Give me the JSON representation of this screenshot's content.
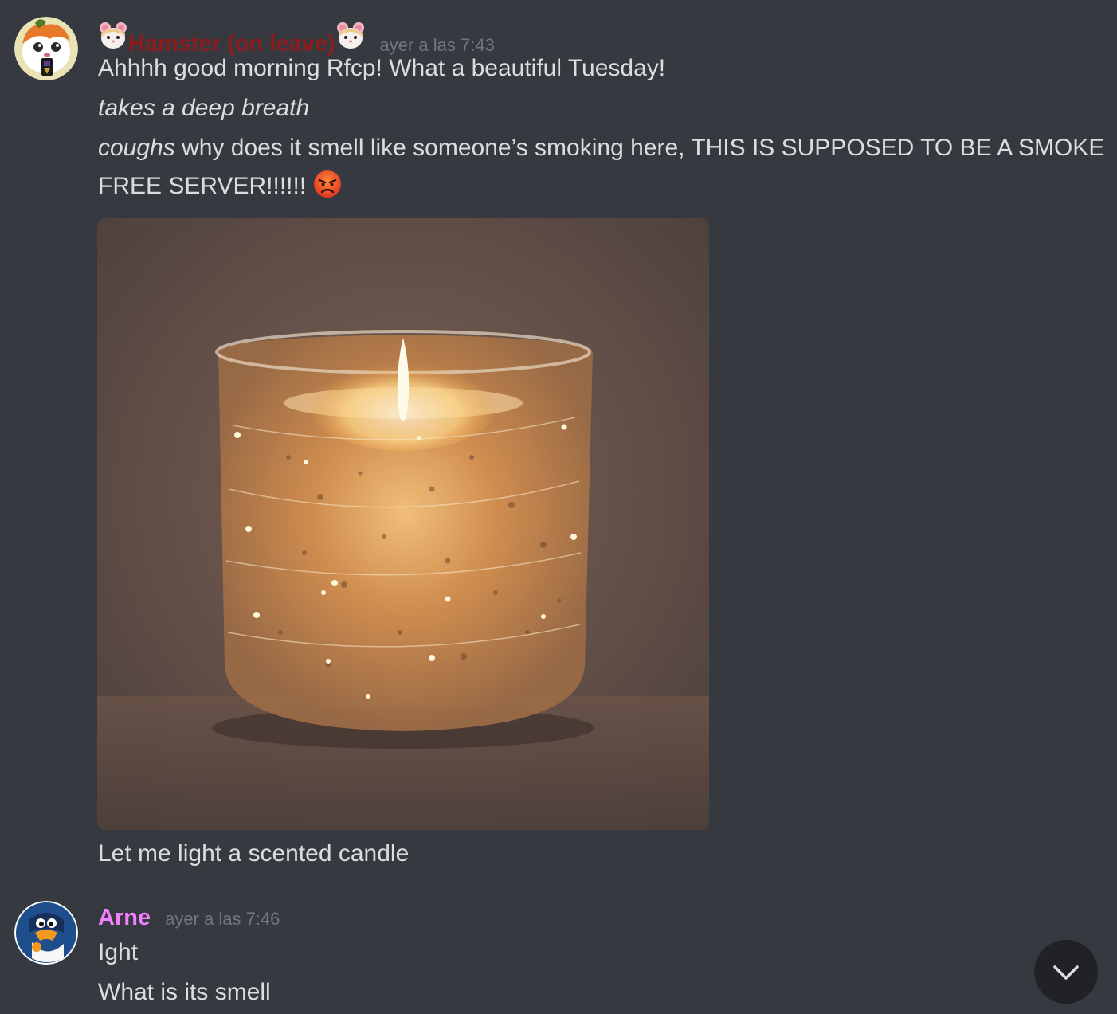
{
  "messages": [
    {
      "author": "Hamster (on leave)",
      "author_color": "#8e1c1c",
      "author_decor_icon": "hamster-face-icon",
      "timestamp": "ayer a las 7:43",
      "lines": {
        "l1": "Ahhhh good morning Rfcp!  What a beautiful Tuesday!",
        "l2": "takes a deep breath",
        "l3_italic": "coughs",
        "l3_rest": " why does it smell like someone’s smoking here, THIS IS SUPPOSED TO BE A SMOKE",
        "l4": "FREE SERVER!!!!!! ",
        "l4_emoji_icon": "angry-face-icon",
        "l5": "Let me light a scented candle"
      },
      "attachment_icon": "candle-image"
    },
    {
      "author": "Arne",
      "author_color": "#f47fff",
      "timestamp": "ayer a las 7:46",
      "lines": {
        "l1": "Ight",
        "l2": "What is its smell"
      }
    }
  ],
  "scroll_button_icon": "chevron-down-icon"
}
